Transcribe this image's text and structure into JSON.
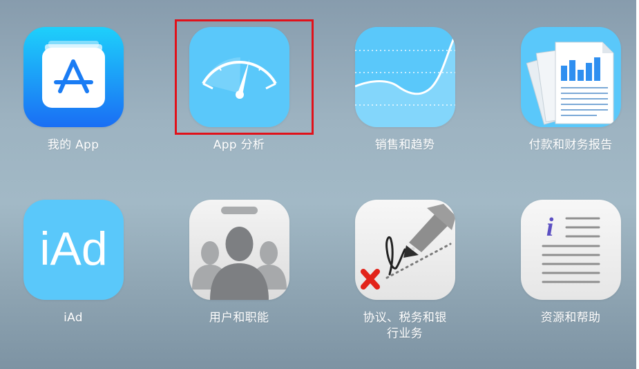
{
  "apps": [
    {
      "id": "my-apps",
      "label": "我的 App",
      "icon": "app-store-icon"
    },
    {
      "id": "app-analytics",
      "label": "App 分析",
      "icon": "gauge-icon"
    },
    {
      "id": "sales-trends",
      "label": "销售和趋势",
      "icon": "trend-chart-icon"
    },
    {
      "id": "payments",
      "label": "付款和财务报告",
      "icon": "financial-report-icon"
    },
    {
      "id": "iad",
      "label": "iAd",
      "icon": "iad-icon",
      "icon_text": "iAd"
    },
    {
      "id": "users-roles",
      "label": "用户和职能",
      "icon": "users-icon"
    },
    {
      "id": "agreements",
      "label": "协议、税务和银",
      "label_line2": "行业务",
      "icon": "signature-pen-icon"
    },
    {
      "id": "resources",
      "label": "资源和帮助",
      "icon": "info-document-icon",
      "icon_text": "i"
    }
  ],
  "selected_app": "app-analytics",
  "colors": {
    "highlight": "#e1111a",
    "label": "#ffffff",
    "icon_blue": "#5ac8fa"
  }
}
